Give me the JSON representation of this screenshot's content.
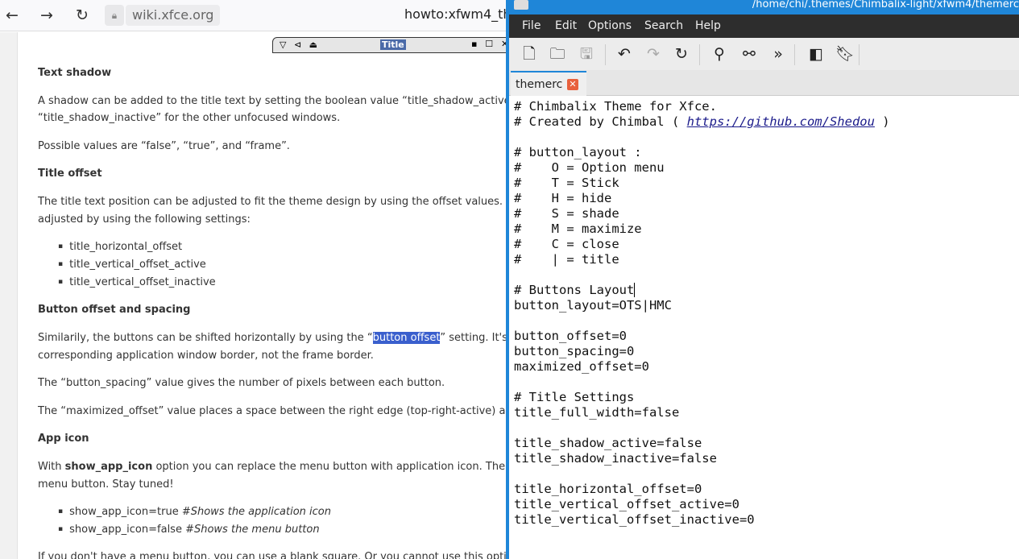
{
  "browser": {
    "url": "wiki.xfce.org",
    "page_title": "howto:xfwm4_th",
    "preview": {
      "title": "Title",
      "left_buttons": "▽ ⊲ ⏏",
      "right_buttons": "▪ ☐ ✕"
    },
    "content": [
      {
        "type": "h",
        "text": "Text shadow"
      },
      {
        "type": "p",
        "text": "A shadow can be added to the title text by setting the boolean value “title_shadow_active”"
      },
      {
        "type": "p",
        "text": "“title_shadow_inactive” for the other unfocused windows."
      },
      {
        "type": "p",
        "text": "Possible values are “false”, “true”, and “frame”."
      },
      {
        "type": "h",
        "text": "Title offset"
      },
      {
        "type": "p",
        "text": "The title text position can be adjusted to fit the theme design by using the offset values. Th"
      },
      {
        "type": "p",
        "text": "adjusted by using the following settings:"
      },
      {
        "type": "li",
        "text": "title_horizontal_offset"
      },
      {
        "type": "li",
        "text": "title_vertical_offset_active"
      },
      {
        "type": "li",
        "text": "title_vertical_offset_inactive"
      },
      {
        "type": "h",
        "text": "Button offset and spacing"
      },
      {
        "type": "p",
        "pre": "Similarily, the buttons can be shifted horizontally by using the “",
        "hl": "button offset",
        "post": "” setting. It's"
      },
      {
        "type": "p",
        "text": "corresponding application window border, not the frame border."
      },
      {
        "type": "p",
        "text": "The “button_spacing” value gives the number of pixels between each button."
      },
      {
        "type": "p",
        "text": "The “maximized_offset” value places a space between the right edge (top-right-active) and"
      },
      {
        "type": "h",
        "text": "App icon"
      },
      {
        "type": "p",
        "pre": "With ",
        "bold": "show_app_icon",
        "post": " option you can replace the menu button with application icon. The a"
      },
      {
        "type": "p",
        "text": "menu button. Stay tuned!"
      },
      {
        "type": "li",
        "pre": "show_app_icon=true #",
        "it": "Shows the application icon"
      },
      {
        "type": "li",
        "pre": "show_app_icon=false #",
        "it": "Shows the menu button"
      },
      {
        "type": "p",
        "text": "If you don't have a menu button, you can use a blank square. Or you cannot use this option"
      }
    ]
  },
  "editor": {
    "title": "/home/chi/.themes/Chimbalix-light/xfwm4/themerc",
    "menu": [
      "File",
      "Edit",
      "Options",
      "Search",
      "Help"
    ],
    "tab": "themerc",
    "link": "https://github.com/Shedou",
    "lines": [
      "# Chimbalix Theme for Xfce.",
      "# Created by Chimbal ( @LINK@ )",
      "",
      "# button_layout :",
      "#    O = Option menu",
      "#    T = Stick",
      "#    H = hide",
      "#    S = shade",
      "#    M = maximize",
      "#    C = close",
      "#    | = title",
      "",
      "# Buttons Layout",
      "button_layout=OTS|HMC",
      "",
      "button_offset=0",
      "button_spacing=0",
      "maximized_offset=0",
      "",
      "# Title Settings",
      "title_full_width=false",
      "",
      "title_shadow_active=false",
      "title_shadow_inactive=false",
      "",
      "title_horizontal_offset=0",
      "title_vertical_offset_active=0",
      "title_vertical_offset_inactive=0"
    ]
  }
}
